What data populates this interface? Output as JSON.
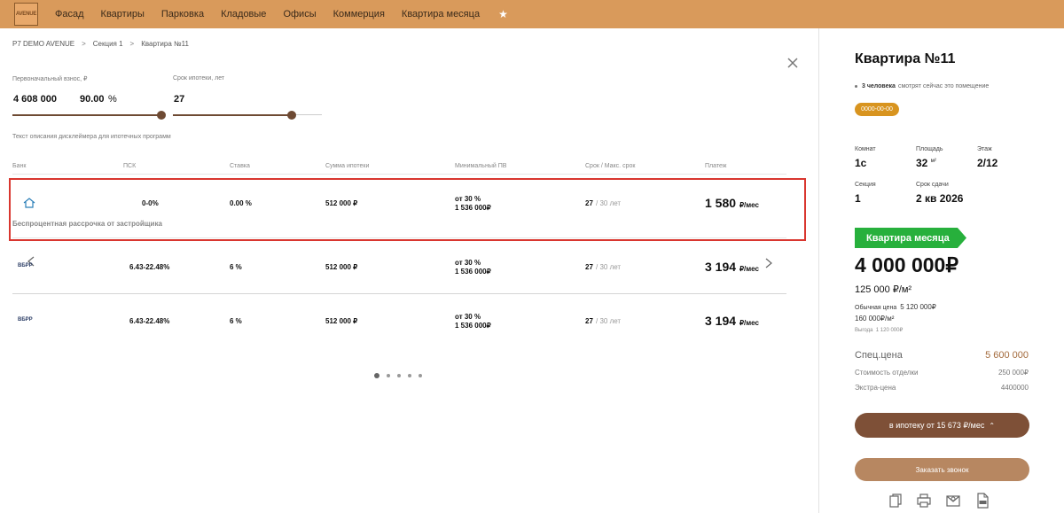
{
  "nav": {
    "logo": "AVENUE",
    "items": [
      "Фасад",
      "Квартиры",
      "Парковка",
      "Кладовые",
      "Офисы",
      "Коммерция",
      "Квартира месяца"
    ],
    "star_icon": "star-icon"
  },
  "breadcrumb": [
    "P7 DEMO AVENUE",
    "Секция 1",
    "Квартира №11"
  ],
  "calculator": {
    "down_payment_label": "Первоначальный взнос, ₽",
    "down_payment_value": "4 608 000",
    "down_payment_percent": "90.00",
    "percent_sign": "%",
    "down_payment_fill": 1.0,
    "term_label": "Срок ипотеки, лет",
    "term_value": "27",
    "term_fill": 0.8,
    "disclaimer": "Текст описания дисклеймера для ипотечных программ"
  },
  "table": {
    "headers": [
      "Банк",
      "ПСК",
      "Ставка",
      "Сумма ипотеки",
      "Минимальный ПВ",
      "Срок / Макс. срок",
      "Платеж"
    ],
    "rows": [
      {
        "bank_logo": "house-icon",
        "psk": "0-0%",
        "rate": "0.00 %",
        "amount": "512 000 ₽",
        "min_pv_pct": "от 30 %",
        "min_pv_sum": "1 536 000₽",
        "term": "27",
        "max_term": "/ 30 лет",
        "payment": "1 580",
        "payment_unit": "₽/мес",
        "program": "Беспроцентная рассрочка от застройщика"
      },
      {
        "bank_logo": "ВБРР",
        "psk": "6.43-22.48%",
        "rate": "6 %",
        "amount": "512 000 ₽",
        "min_pv_pct": "от 30 %",
        "min_pv_sum": "1 536 000₽",
        "term": "27",
        "max_term": "/ 30 лет",
        "payment": "3 194",
        "payment_unit": "₽/мес"
      },
      {
        "bank_logo": "ВБРР",
        "psk": "6.43-22.48%",
        "rate": "6 %",
        "amount": "512 000 ₽",
        "min_pv_pct": "от 30 %",
        "min_pv_sum": "1 536 000₽",
        "term": "27",
        "max_term": "/ 30 лет",
        "payment": "3 194",
        "payment_unit": "₽/мес"
      }
    ],
    "pagination_dots": 5,
    "active_dot": 0
  },
  "panel": {
    "title": "Квартира №11",
    "viewers_count": "3 человека",
    "viewers_text": "смотрят сейчас это помещение",
    "date_badge": "0000-00-00",
    "rooms_label": "Комнат",
    "rooms_value": "1с",
    "area_label": "Площадь",
    "area_value": "32",
    "area_unit": "м²",
    "floor_label": "Этаж",
    "floor_value": "2/12",
    "section_label": "Секция",
    "section_value": "1",
    "delivery_label": "Срок сдачи",
    "delivery_value": "2 кв 2026",
    "month_badge": "Квартира месяца",
    "price": "4 000 000₽",
    "price_per_m": "125 000 ₽/м²",
    "regular_price_label": "Обычная цена",
    "regular_price_value": "5 120 000₽",
    "regular_per_m": "160 000₽/м²",
    "benefit_label": "Выгода",
    "benefit_value": "1 120 000₽",
    "spec_price_label": "Спец.цена",
    "spec_price_value": "5 600 000",
    "finish_label": "Стоимость отделки",
    "finish_value": "250 000₽",
    "extra_label": "Экстра-цена",
    "extra_value": "4400000",
    "mortgage_button": "в ипотеку от 15 673 ₽/мес",
    "call_button": "Заказать звонок",
    "icons": [
      "copy-icon",
      "print-icon",
      "mail-icon",
      "pdf-icon"
    ]
  },
  "colors": {
    "topbar": "#d99a5b",
    "brown": "#7e5037",
    "green": "#27b03c",
    "badge": "#d8941f",
    "highlight": "#d9362f"
  }
}
